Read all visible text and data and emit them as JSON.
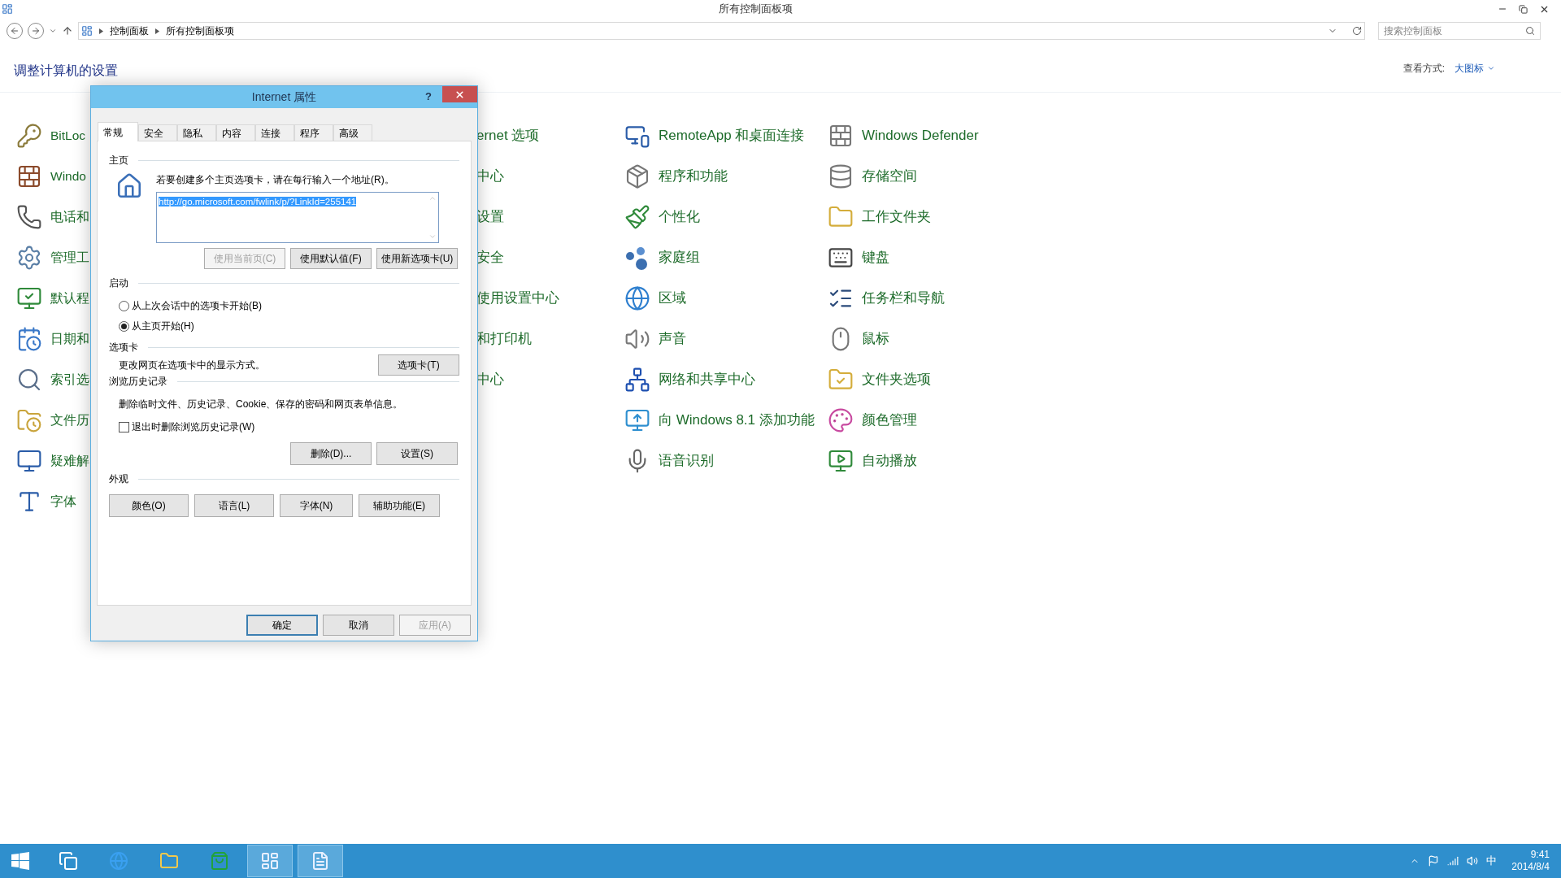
{
  "window": {
    "title": "所有控制面板项"
  },
  "address_bar": {
    "breadcrumbs": [
      "控制面板",
      "所有控制面板项"
    ]
  },
  "search": {
    "placeholder": "搜索控制面板"
  },
  "header": {
    "title": "调整计算机的设置",
    "view_label": "查看方式:",
    "view_value": "大图标"
  },
  "columns": [
    {
      "items": [
        {
          "label": "BitLoc"
        },
        {
          "label": "Windo"
        },
        {
          "label": "电话和"
        },
        {
          "label": "管理工"
        },
        {
          "label": "默认程"
        },
        {
          "label": "日期和"
        },
        {
          "label": "索引选"
        },
        {
          "label": "文件历"
        },
        {
          "label": "疑难解"
        },
        {
          "label": "字体"
        }
      ]
    },
    {
      "items": [
        {
          "label": "ernet 选项"
        },
        {
          "label": "中心"
        },
        {
          "label": "设置"
        },
        {
          "label": "安全"
        },
        {
          "label": "使用设置中心"
        },
        {
          "label": "和打印机"
        },
        {
          "label": "中心"
        }
      ]
    },
    {
      "items": [
        {
          "label": "RemoteApp 和桌面连接"
        },
        {
          "label": "程序和功能"
        },
        {
          "label": "个性化"
        },
        {
          "label": "家庭组"
        },
        {
          "label": "区域"
        },
        {
          "label": "声音"
        },
        {
          "label": "网络和共享中心"
        },
        {
          "label": "向 Windows 8.1 添加功能"
        },
        {
          "label": "语音识别"
        }
      ]
    },
    {
      "items": [
        {
          "label": "Windows Defender"
        },
        {
          "label": "存储空间"
        },
        {
          "label": "工作文件夹"
        },
        {
          "label": "键盘"
        },
        {
          "label": "任务栏和导航"
        },
        {
          "label": "鼠标"
        },
        {
          "label": "文件夹选项"
        },
        {
          "label": "颜色管理"
        },
        {
          "label": "自动播放"
        }
      ]
    }
  ],
  "dialog": {
    "title": "Internet 属性",
    "help": "?",
    "tabs": [
      {
        "label": "常规",
        "selected": true
      },
      {
        "label": "安全",
        "selected": false
      },
      {
        "label": "隐私",
        "selected": false
      },
      {
        "label": "内容",
        "selected": false
      },
      {
        "label": "连接",
        "selected": false
      },
      {
        "label": "程序",
        "selected": false
      },
      {
        "label": "高级",
        "selected": false
      }
    ],
    "homepage": {
      "label": "主页",
      "description": "若要创建多个主页选项卡，请在每行输入一个地址(R)。",
      "value": "http://go.microsoft.com/fwlink/p/?LinkId=255141",
      "buttons": [
        {
          "label": "使用当前页(C)",
          "disabled": true
        },
        {
          "label": "使用默认值(F)",
          "disabled": false
        },
        {
          "label": "使用新选项卡(U)",
          "disabled": false
        }
      ]
    },
    "startup": {
      "label": "启动",
      "options": [
        {
          "label": "从上次会话中的选项卡开始(B)",
          "selected": false
        },
        {
          "label": "从主页开始(H)",
          "selected": true
        }
      ]
    },
    "tabs_section": {
      "label": "选项卡",
      "description": "更改网页在选项卡中的显示方式。",
      "button": "选项卡(T)"
    },
    "history": {
      "label": "浏览历史记录",
      "description": "删除临时文件、历史记录、Cookie、保存的密码和网页表单信息。",
      "checkbox": {
        "label": "退出时删除浏览历史记录(W)",
        "checked": false
      },
      "buttons": [
        "删除(D)...",
        "设置(S)"
      ]
    },
    "appearance": {
      "label": "外观",
      "buttons": [
        "颜色(O)",
        "语言(L)",
        "字体(N)",
        "辅助功能(E)"
      ]
    },
    "footer": [
      {
        "label": "确定",
        "disabled": false,
        "default": true
      },
      {
        "label": "取消",
        "disabled": false,
        "default": false
      },
      {
        "label": "应用(A)",
        "disabled": true,
        "default": false
      }
    ]
  },
  "taskbar": {
    "apps": [
      {
        "active": false
      },
      {
        "active": false
      },
      {
        "active": false
      },
      {
        "active": false
      },
      {
        "active": true
      },
      {
        "active": true
      }
    ],
    "ime": "中",
    "time": "9:41",
    "date": "2014/8/4"
  }
}
